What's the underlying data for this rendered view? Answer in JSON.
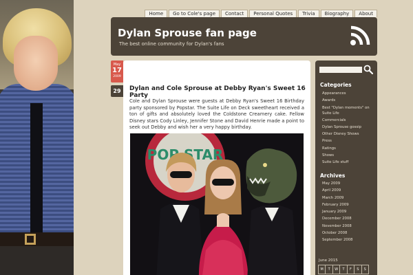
{
  "site": {
    "title": "Dylan Sprouse fan page",
    "tagline": "The best online community for Dylan's fans"
  },
  "nav": {
    "items": [
      "Home",
      "Go to Cole's page",
      "Contact",
      "Personal Quotes",
      "Trivia",
      "Biography",
      "About"
    ]
  },
  "post": {
    "date": {
      "month": "May",
      "day": "17",
      "year": "2009"
    },
    "comments": "29",
    "title": "Dylan and Cole Sprouse at Debby Ryan's Sweet 16 Party",
    "body": "Cole and Dylan Sprouse were guests at Debby Ryan's Sweet 16 Birthday party sponsored by Popstar. The Suite Life on Deck sweetheart received a ton of gifts and absolutely loved the Coldstone Creamery cake. Fellow Disney stars Cody Linley, Jennifer Stone and David Henrie made a point to seek out Debby and wish her a very happy birthday.",
    "photo_sign_text": "POP STAR"
  },
  "sidebar": {
    "search_placeholder": "",
    "categories_heading": "Categories",
    "categories": [
      "Appearances",
      "Awards",
      "Best \"Dylan moments\" on Suite Life",
      "Commercials",
      "Dylan Sprouse gossip",
      "Other Disney Shows",
      "Press",
      "Ratings",
      "Shows",
      "Suite Life stuff"
    ],
    "archives_heading": "Archives",
    "archives": [
      "May 2009",
      "April 2009",
      "March 2009",
      "February 2009",
      "January 2009",
      "December 2008",
      "November 2008",
      "October 2008",
      "September 2008"
    ],
    "calendar_caption": "June 2015",
    "calendar_days": [
      "M",
      "T",
      "W",
      "T",
      "F",
      "S",
      "S"
    ]
  },
  "colors": {
    "header_bg": "#4c4338",
    "page_bg": "#ddd3bd",
    "date_badge": "#d8594c"
  },
  "icons": {
    "feed": "rss-icon",
    "search": "search-icon"
  }
}
